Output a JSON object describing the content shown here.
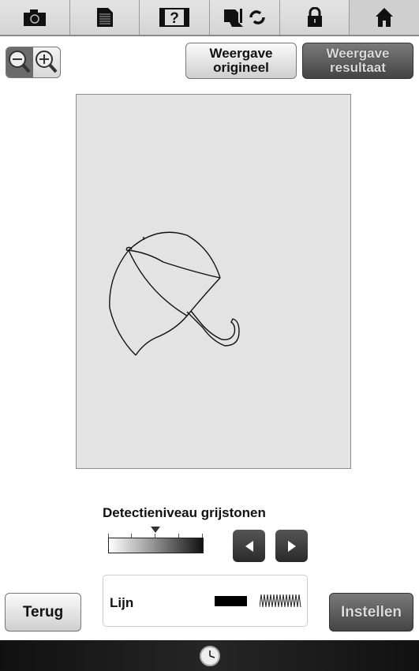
{
  "toolbar": {
    "tabs": [
      {
        "icon": "camera-icon"
      },
      {
        "icon": "document-icon"
      },
      {
        "icon": "help-video-icon"
      },
      {
        "icon": "sewing-machine-reset-icon"
      },
      {
        "icon": "lock-icon"
      },
      {
        "icon": "home-icon"
      }
    ]
  },
  "zoom": {
    "out_icon": "zoom-out-icon",
    "in_icon": "zoom-in-icon",
    "active": "zoom-out"
  },
  "view": {
    "original_label": "Weergave\norigineel",
    "result_label": "Weergave\nresultaat",
    "active": "result"
  },
  "detection": {
    "title": "Detectieniveau grijstonen",
    "level_fraction": 0.5,
    "steps": 4
  },
  "line_panel": {
    "label": "Lijn"
  },
  "buttons": {
    "back": "Terug",
    "set": "Instellen"
  },
  "statusbar": {
    "icon": "clock-icon"
  }
}
